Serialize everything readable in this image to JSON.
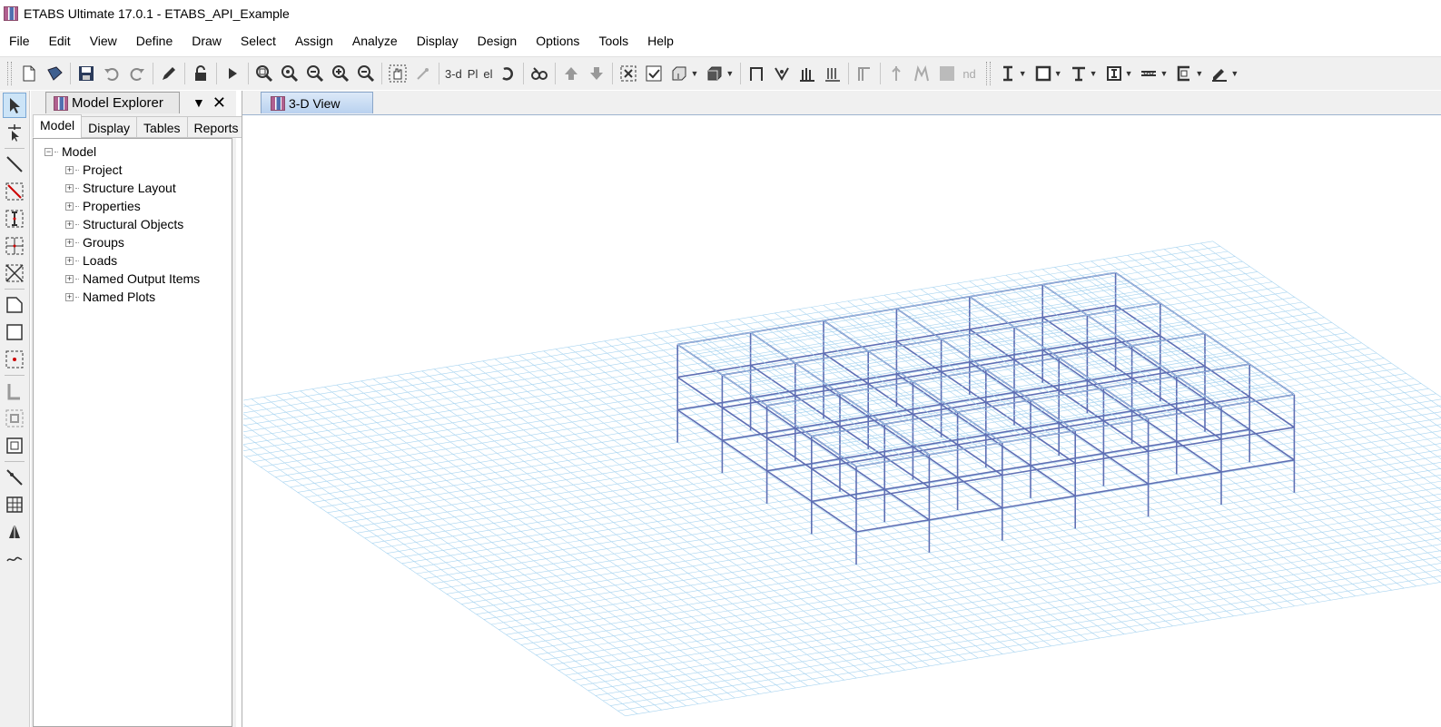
{
  "window": {
    "title": "ETABS Ultimate 17.0.1 - ETABS_API_Example"
  },
  "menu": [
    "File",
    "Edit",
    "View",
    "Define",
    "Draw",
    "Select",
    "Assign",
    "Analyze",
    "Display",
    "Design",
    "Options",
    "Tools",
    "Help"
  ],
  "toolbar": {
    "view_3d_label": "3-d",
    "plan_label": "Pl",
    "elev_label": "el",
    "nd_label": "nd",
    "icons": [
      "new-file-icon",
      "open-file-icon",
      "save-icon",
      "undo-icon",
      "redo-icon",
      "pencil-icon",
      "lock-icon",
      "run-icon",
      "zoom-window-icon",
      "zoom-restore-icon",
      "zoom-previous-icon",
      "zoom-in-icon",
      "zoom-out-icon",
      "pan-icon",
      "3d-view-icon",
      "plan-view-icon",
      "elevation-view-icon",
      "rotate-icon",
      "perspective-icon",
      "move-up-icon",
      "move-down-icon"
    ]
  },
  "explorer": {
    "title": "Model Explorer",
    "tabs": [
      "Model",
      "Display",
      "Tables",
      "Reports"
    ],
    "active_tab": "Model",
    "tree": {
      "root": "Model",
      "children": [
        "Project",
        "Structure Layout",
        "Properties",
        "Structural Objects",
        "Groups",
        "Loads",
        "Named Output Items",
        "Named Plots"
      ]
    }
  },
  "view": {
    "tab_label": "3-D View"
  },
  "colors": {
    "grid_line": "#a8d4f0",
    "frame": "#5f6fb4",
    "tab_active": "#b9d1ef"
  }
}
